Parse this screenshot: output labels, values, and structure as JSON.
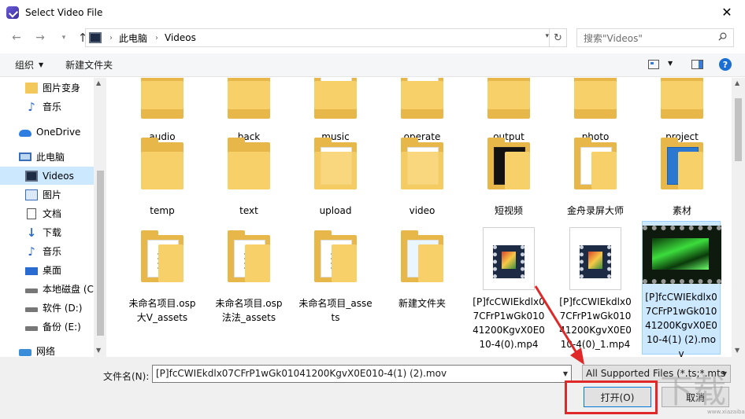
{
  "window": {
    "title": "Select Video File",
    "close": "✕"
  },
  "nav": {
    "breadcrumb": [
      "此电脑",
      "Videos"
    ],
    "search_placeholder": "搜索\"Videos\""
  },
  "toolbar": {
    "organize": "组织",
    "new_folder": "新建文件夹",
    "help": "?"
  },
  "sidebar": {
    "items": [
      {
        "label": "图片变身",
        "icon": "folder-icon"
      },
      {
        "label": "音乐",
        "icon": "music-icon"
      },
      {
        "label": "OneDrive",
        "icon": "cloud-icon"
      },
      {
        "label": "此电脑",
        "icon": "pc-icon"
      },
      {
        "label": "Videos",
        "icon": "video-folder-icon",
        "selected": true
      },
      {
        "label": "图片",
        "icon": "pictures-icon"
      },
      {
        "label": "文档",
        "icon": "documents-icon"
      },
      {
        "label": "下载",
        "icon": "download-icon"
      },
      {
        "label": "音乐",
        "icon": "music-icon"
      },
      {
        "label": "桌面",
        "icon": "desktop-icon"
      },
      {
        "label": "本地磁盘 (C",
        "icon": "drive-icon"
      },
      {
        "label": "软件 (D:)",
        "icon": "drive-icon"
      },
      {
        "label": "备份 (E:)",
        "icon": "drive-icon"
      },
      {
        "label": "网络",
        "icon": "network-icon"
      }
    ]
  },
  "files": {
    "row1": [
      "audio",
      "back",
      "music",
      "operate",
      "output",
      "photo",
      "project"
    ],
    "row2": [
      "temp",
      "text",
      "upload",
      "video",
      "短视频",
      "金舟录屏大师",
      "素材"
    ],
    "row3": [
      "未命名项目.osp大V_assets",
      "未命名项目.osp法法_assets",
      "未命名项目_assets",
      "新建文件夹",
      "[P]fcCWIEkdlx07CFrP1wGk01041200KgvX0E010-4(0).mp4",
      "[P]fcCWIEkdlx07CFrP1wGk01041200KgvX0E010-4(0)_1.mp4",
      "[P]fcCWIEkdlx07CFrP1wGk01041200KgvX0E010-4(1) (2).mov"
    ]
  },
  "bottom": {
    "filename_label": "文件名(N):",
    "filename_value": "[P]fcCWIEkdlx07CFrP1wGk01041200KgvX0E010-4(1) (2).mov",
    "filetype": "All Supported Files (*.ts;*.mts",
    "open": "打开(O)",
    "cancel": "取消"
  },
  "watermark": {
    "big": "下载",
    "small": "www.xiazaiba.com"
  },
  "colors": {
    "selection": "#cce8ff",
    "highlight": "#e02828",
    "folder": "#f7d069"
  }
}
